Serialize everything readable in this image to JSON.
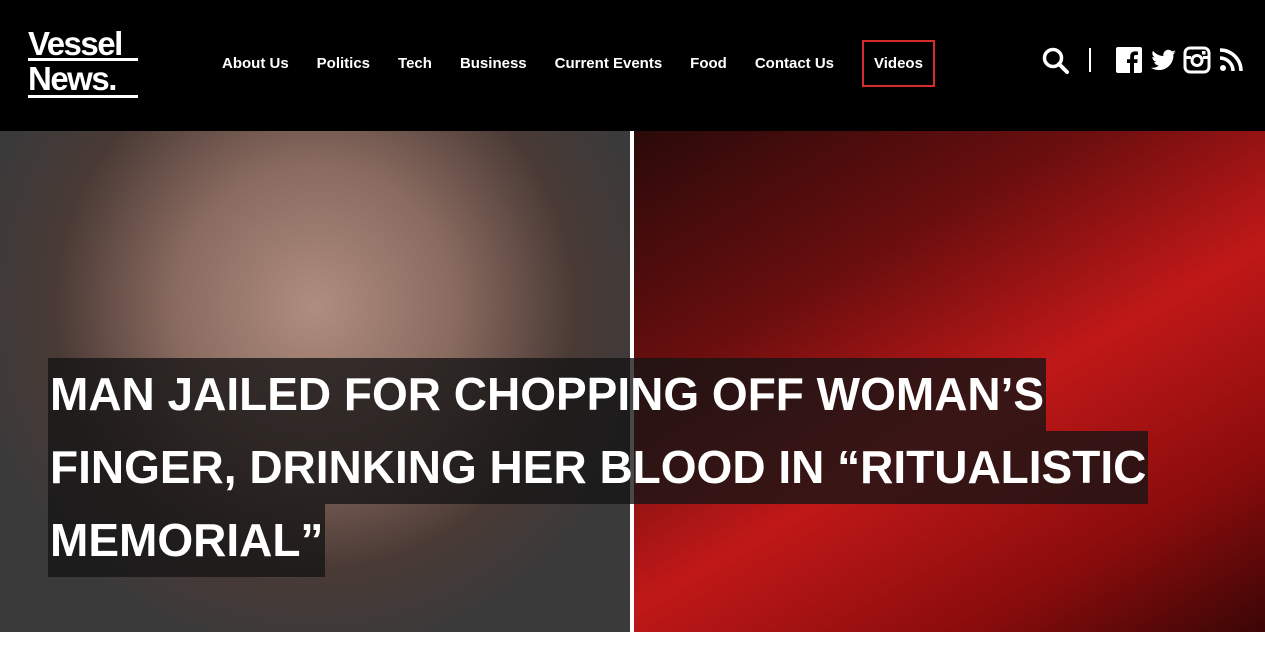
{
  "brand": {
    "logo_line1": "Vessel",
    "logo_line2": "News.",
    "accent_color": "#d52b2b"
  },
  "nav": {
    "items": [
      {
        "label": "About Us"
      },
      {
        "label": "Politics"
      },
      {
        "label": "Tech"
      },
      {
        "label": "Business"
      },
      {
        "label": "Current Events"
      },
      {
        "label": "Food"
      },
      {
        "label": "Contact Us"
      },
      {
        "label": "Videos",
        "active": true
      }
    ]
  },
  "tools": {
    "icons": [
      "search-icon",
      "facebook-icon",
      "twitter-icon",
      "instagram-icon",
      "rss-icon"
    ]
  },
  "hero": {
    "headline_lines": [
      "MAN JAILED FOR CHOPPING OFF WOMAN’S",
      "FINGER, DRINKING HER BLOOD IN “RITUALISTIC",
      "MEMORIAL”"
    ]
  }
}
